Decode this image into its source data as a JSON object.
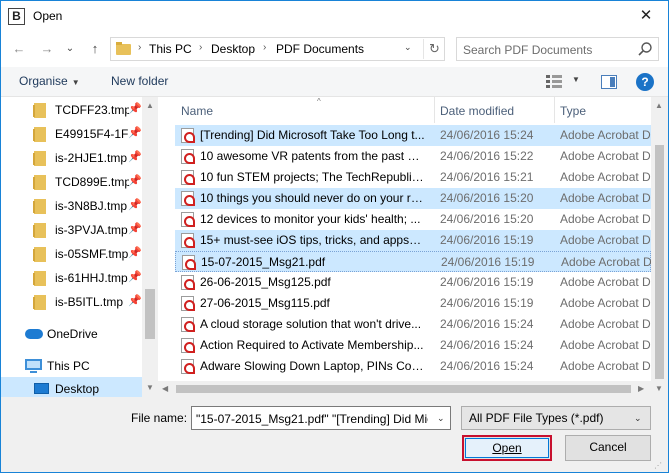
{
  "window": {
    "title": "Open",
    "app_icon_letter": "B",
    "close_glyph": "✕"
  },
  "nav": {
    "back_glyph": "←",
    "forward_glyph": "→",
    "recent_glyph": "⌄",
    "up_glyph": "↑",
    "breadcrumb": [
      "This PC",
      "Desktop",
      "PDF Documents"
    ],
    "separator_glyph": "›",
    "dropdown_glyph": "⌄",
    "refresh_glyph": "↻"
  },
  "search": {
    "placeholder": "Search PDF Documents"
  },
  "toolbar": {
    "organise_label": "Organise",
    "organise_caret": "▼",
    "new_folder_label": "New folder",
    "view_caret": "▼",
    "help_glyph": "?"
  },
  "navpane": {
    "pin_glyph": "📌",
    "quick_items": [
      {
        "label": "TCDFF23.tmp"
      },
      {
        "label": "E49915F4-1F5"
      },
      {
        "label": "is-2HJE1.tmp"
      },
      {
        "label": "TCD899E.tmp"
      },
      {
        "label": "is-3N8BJ.tmp"
      },
      {
        "label": "is-3PVJA.tmp"
      },
      {
        "label": "is-05SMF.tmp"
      },
      {
        "label": "is-61HHJ.tmp"
      },
      {
        "label": "is-B5ITL.tmp"
      }
    ],
    "onedrive_label": "OneDrive",
    "thispc_label": "This PC",
    "desktop_label": "Desktop"
  },
  "columns": {
    "name": "Name",
    "date": "Date modified",
    "type": "Type",
    "sort_glyph": "^"
  },
  "files": [
    {
      "name": "[Trending] Did Microsoft Take Too Long t...",
      "date": "24/06/2016 15:24",
      "type": "Adobe Acrobat D",
      "state": "sel"
    },
    {
      "name": "10 awesome VR patents from the past 25 ...",
      "date": "24/06/2016 15:22",
      "type": "Adobe Acrobat D",
      "state": ""
    },
    {
      "name": "10 fun STEM projects; The TechRepublic ...",
      "date": "24/06/2016 15:21",
      "type": "Adobe Acrobat D",
      "state": ""
    },
    {
      "name": "10 things you should never do on your re...",
      "date": "24/06/2016 15:20",
      "type": "Adobe Acrobat D",
      "state": "sel"
    },
    {
      "name": "12 devices to monitor your kids' health; ...",
      "date": "24/06/2016 15:20",
      "type": "Adobe Acrobat D",
      "state": ""
    },
    {
      "name": "15+ must-see iOS tips, tricks, and apps_1...",
      "date": "24/06/2016 15:19",
      "type": "Adobe Acrobat D",
      "state": "sel"
    },
    {
      "name": "15-07-2015_Msg21.pdf",
      "date": "24/06/2016 15:19",
      "type": "Adobe Acrobat D",
      "state": "focus"
    },
    {
      "name": "26-06-2015_Msg125.pdf",
      "date": "24/06/2016 15:19",
      "type": "Adobe Acrobat D",
      "state": ""
    },
    {
      "name": "27-06-2015_Msg115.pdf",
      "date": "24/06/2016 15:19",
      "type": "Adobe Acrobat D",
      "state": ""
    },
    {
      "name": "A cloud storage solution that won't drive...",
      "date": "24/06/2016 15:24",
      "type": "Adobe Acrobat D",
      "state": ""
    },
    {
      "name": "Action Required to Activate Membership...",
      "date": "24/06/2016 15:24",
      "type": "Adobe Acrobat D",
      "state": ""
    },
    {
      "name": "Adware Slowing Down Laptop, PINs Coul...",
      "date": "24/06/2016 15:24",
      "type": "Adobe Acrobat D",
      "state": ""
    }
  ],
  "bottom": {
    "filename_label": "File name:",
    "filename_value": "\"15-07-2015_Msg21.pdf\" \"[Trending] Did Mic",
    "filetype_value": "All PDF File Types (*.pdf)",
    "dd_glyph": "⌄",
    "open_label": "Open",
    "cancel_label": "Cancel"
  },
  "colors": {
    "selection": "#cce8ff",
    "accent": "#0078d7",
    "highlight_border": "#c8102e"
  }
}
